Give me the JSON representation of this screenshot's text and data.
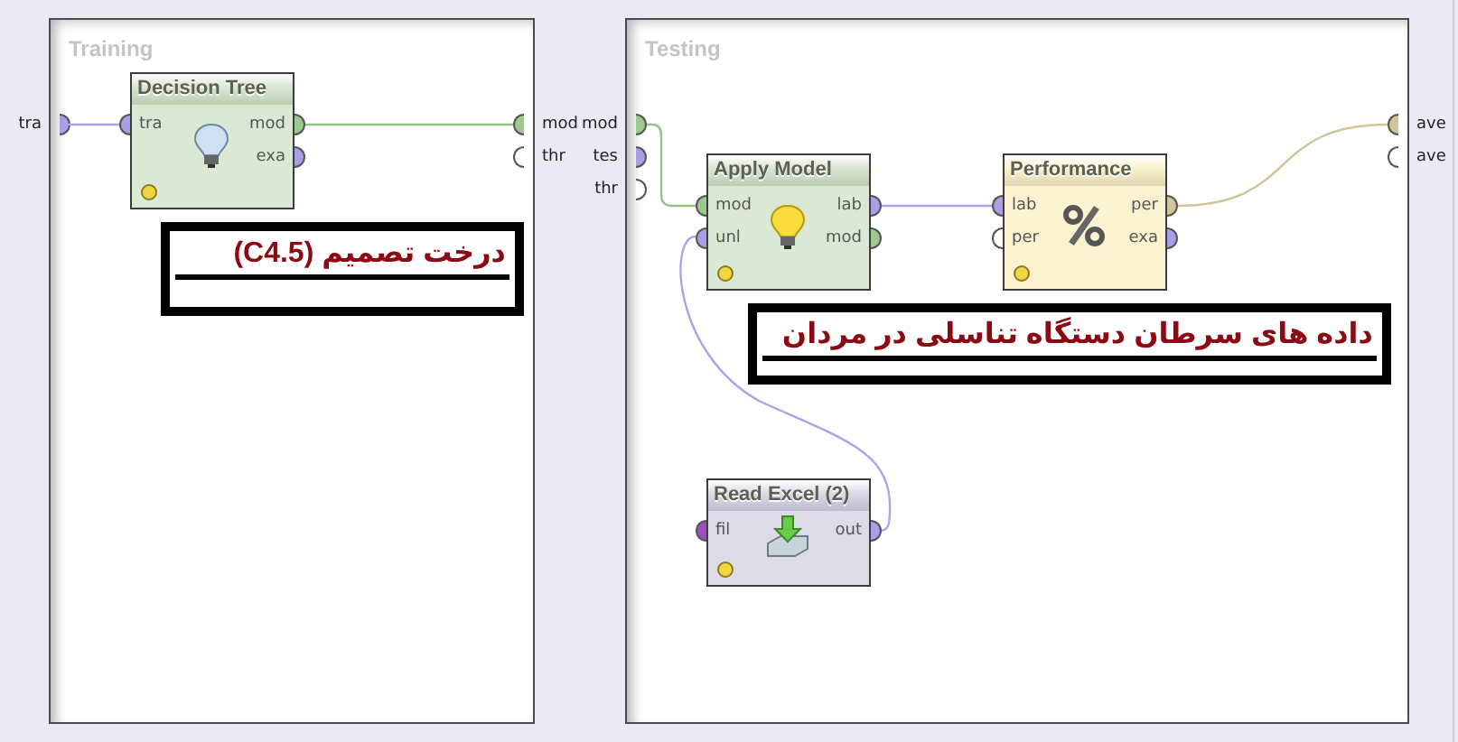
{
  "panels": [
    {
      "title": "Training",
      "inputs": [
        {
          "label": "tra",
          "color": "#a99ee8"
        }
      ],
      "outputs": [
        {
          "label": "mod",
          "color": "#9cc98c"
        },
        {
          "label": "thr",
          "color": "#ffffff"
        }
      ]
    },
    {
      "title": "Testing",
      "inputs": [
        {
          "label": "mod",
          "color": "#9cc98c"
        },
        {
          "label": "tes",
          "color": "#a99ee8"
        },
        {
          "label": "thr",
          "color": "#ffffff"
        }
      ],
      "outputs": [
        {
          "label": "ave",
          "color": "#d2c49a"
        },
        {
          "label": "ave",
          "color": "#ffffff"
        }
      ]
    }
  ],
  "operators": [
    {
      "name": "Decision Tree",
      "kind": "learner",
      "inputs": [
        {
          "label": "tra",
          "color": "#a99ee8"
        }
      ],
      "outputs": [
        {
          "label": "mod",
          "color": "#9cc98c"
        },
        {
          "label": "exa",
          "color": "#a99ee8"
        }
      ]
    },
    {
      "name": "Apply Model",
      "kind": "apply",
      "inputs": [
        {
          "label": "mod",
          "color": "#9cc98c"
        },
        {
          "label": "unl",
          "color": "#a99ee8"
        }
      ],
      "outputs": [
        {
          "label": "lab",
          "color": "#a99ee8"
        },
        {
          "label": "mod",
          "color": "#9cc98c"
        }
      ]
    },
    {
      "name": "Performance",
      "kind": "evaluation",
      "inputs": [
        {
          "label": "lab",
          "color": "#a99ee8"
        },
        {
          "label": "per",
          "color": "#ffffff"
        }
      ],
      "outputs": [
        {
          "label": "per",
          "color": "#d2c49a"
        },
        {
          "label": "exa",
          "color": "#a99ee8"
        }
      ]
    },
    {
      "name": "Read Excel (2)",
      "kind": "import",
      "inputs": [
        {
          "label": "fil",
          "color": "#9b4fc0"
        }
      ],
      "outputs": [
        {
          "label": "out",
          "color": "#a99ee8"
        }
      ]
    }
  ],
  "annotations": [
    {
      "text": "درخت تصمیم (C4.5)"
    },
    {
      "text": "داده های سرطان دستگاه تناسلی در مردان"
    }
  ]
}
